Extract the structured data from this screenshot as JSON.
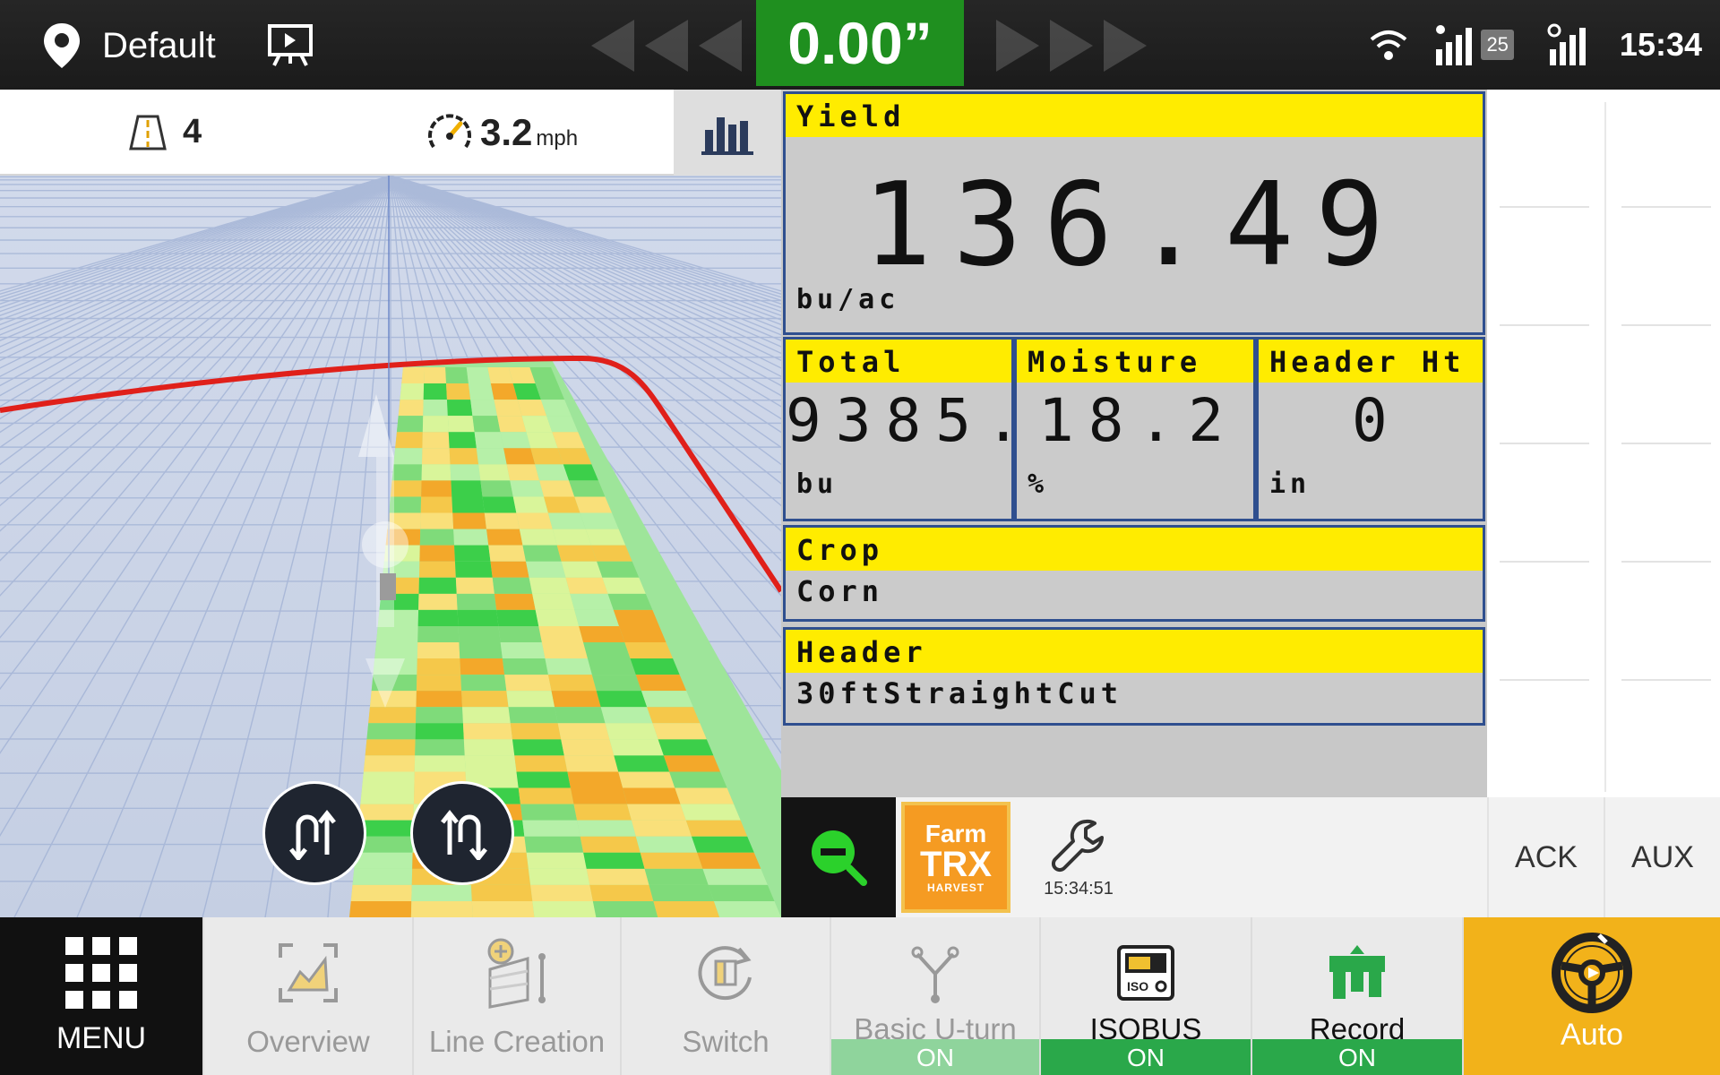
{
  "status_bar": {
    "profile_name": "Default",
    "guidance_offset": "0.00”",
    "satellite_count": "25",
    "clock": "15:34",
    "icons": [
      "location-pin-icon",
      "presentation-icon",
      "wifi-icon",
      "gnss-signal-icon",
      "cellular-signal-icon"
    ]
  },
  "map": {
    "lane_number": "4",
    "speed_value": "3.2",
    "speed_unit": "mph"
  },
  "monitor": {
    "yield": {
      "label": "Yield",
      "value": "136.49",
      "unit": "bu/ac"
    },
    "total": {
      "label": "Total",
      "value": "9385.",
      "unit": "bu"
    },
    "moisture": {
      "label": "Moisture",
      "value": "18.2",
      "unit": "%"
    },
    "header_ht": {
      "label": "Header Ht",
      "value": "0",
      "unit": "in"
    },
    "crop": {
      "label": "Crop",
      "value": "Corn"
    },
    "header": {
      "label": "Header",
      "value": "30ftStraightCut"
    },
    "colors": {
      "header_band": "#ffec00",
      "cell_border": "#2f4f8f",
      "cell_bg": "#cbcbcb"
    }
  },
  "softkeys": {
    "logo_line1": "Farm",
    "logo_line2": "TRX",
    "logo_line3": "HARVEST",
    "wrench_time": "15:34:51",
    "ack": "ACK",
    "aux": "AUX"
  },
  "bottom_bar": {
    "menu": "MENU",
    "overview": "Overview",
    "line_creation": "Line Creation",
    "switch": "Switch",
    "basic_uturn": {
      "label": "Basic U-turn",
      "state": "ON"
    },
    "isobus": {
      "label": "ISOBUS",
      "state": "ON"
    },
    "record": {
      "label": "Record",
      "state": "ON"
    },
    "auto": "Auto"
  },
  "colors": {
    "accent_green": "#1f8f1f",
    "on_green": "#2aa84a",
    "on_green_dim": "#8fd49c",
    "auto_yellow": "#f2b21a",
    "guidance_red": "#e0201a"
  }
}
